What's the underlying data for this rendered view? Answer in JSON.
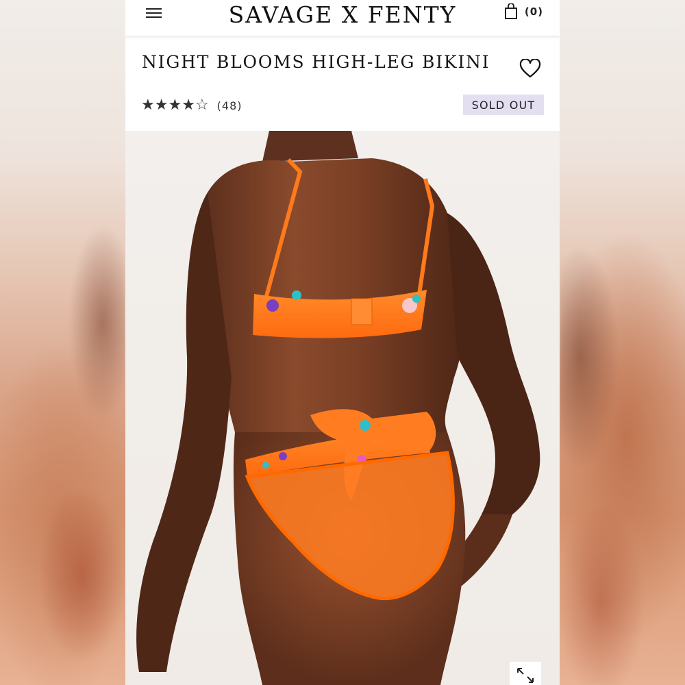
{
  "header": {
    "brand": "SAVAGE X FENTY",
    "cart_count": "(0)",
    "icons": {
      "menu": "hamburger-menu-icon",
      "cart": "shopping-bag-icon"
    }
  },
  "product": {
    "title": "NIGHT BLOOMS HIGH-LEG BIKINI",
    "rating": 4,
    "rating_max": 5,
    "stars": [
      "★",
      "★",
      "★",
      "★",
      "☆"
    ],
    "review_count": "(48)",
    "status_badge": "SOLD OUT",
    "wishlist_icon": "heart-outline-icon",
    "expand_icon": "expand-arrows-icon"
  },
  "colors": {
    "badge_bg": "#e4def1",
    "product_orange": "#ff7a1a",
    "text": "#151515"
  }
}
